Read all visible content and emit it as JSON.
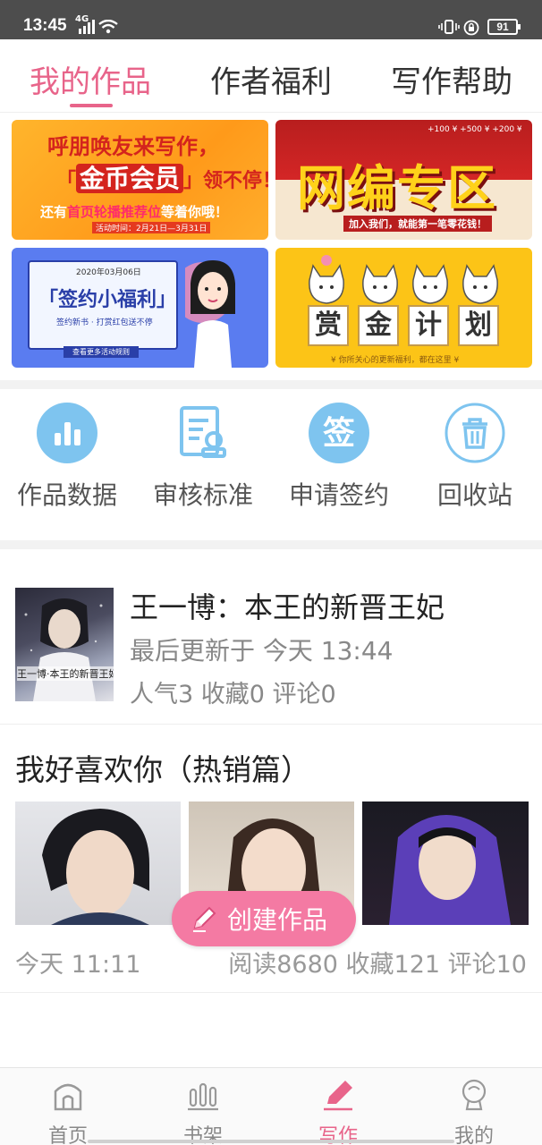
{
  "status_bar": {
    "time": "13:45",
    "network": "4G",
    "battery": "91"
  },
  "tabs": [
    {
      "label": "我的作品",
      "active": true
    },
    {
      "label": "作者福利",
      "active": false
    },
    {
      "label": "写作帮助",
      "active": false
    }
  ],
  "banners": {
    "b1": {
      "line1": "呼朋唤友来写作，",
      "line2_big": "金币会员",
      "line2_rest": "领不停！",
      "line3_pre": "还有",
      "line3_em": "首页轮播推荐位",
      "line3_post": "等着你哦！",
      "line4": "活动时间：2月21日—3月31日"
    },
    "b2": {
      "title": "网编专区",
      "sub": "加入我们，就能第一笔零花钱！",
      "coins": "+100 ¥ +500 ¥ +200 ¥"
    },
    "b3": {
      "date": "2020年03月06日",
      "title": "「签约小福利」",
      "sub": "签约新书 · 打赏红包送不停",
      "button": "查看更多活动规则"
    },
    "b4": {
      "chars": [
        "赏",
        "金",
        "计",
        "划"
      ],
      "foot": "¥ 你所关心的更新福利，都在这里 ¥"
    }
  },
  "tools": [
    {
      "label": "作品数据",
      "icon": "bar-chart-icon"
    },
    {
      "label": "审核标准",
      "icon": "review-document-icon"
    },
    {
      "label": "申请签约",
      "icon": "sign-icon"
    },
    {
      "label": "回收站",
      "icon": "trash-icon"
    }
  ],
  "books": [
    {
      "title": "王一博：本王的新晋王妃",
      "updated": "最后更新于 今天 13:44",
      "stats": "人气3 收藏0 评论0",
      "cover_caption": "王一博·本王的新晋王妃"
    },
    {
      "title": "我好喜欢你（热销篇）",
      "time": "今天 11:11",
      "stats": "阅读8680 收藏121 评论10"
    }
  ],
  "fab": {
    "label": "创建作品"
  },
  "bottom_nav": [
    {
      "label": "首页",
      "icon": "home-icon",
      "active": false
    },
    {
      "label": "书架",
      "icon": "bookshelf-icon",
      "active": false
    },
    {
      "label": "写作",
      "icon": "pen-icon",
      "active": true
    },
    {
      "label": "我的",
      "icon": "profile-icon",
      "active": false
    }
  ],
  "colors": {
    "accent": "#e8648a",
    "fab": "#f47aa3",
    "tool_icon": "#7ec4ef"
  }
}
